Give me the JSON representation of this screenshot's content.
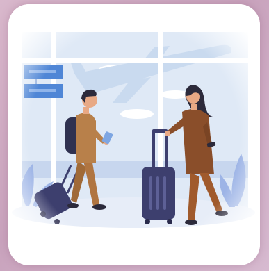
{
  "illustration": {
    "subject": "airport-travelers",
    "colors": {
      "sky": "#d8e6f6",
      "window_frame": "#ffffff",
      "board": "#4f86d6",
      "plane": "#c9daef",
      "floor": "#6b7fb1",
      "suitcase": "#3d3f6e",
      "man_shirt": "#b8804a",
      "man_hair": "#2c2a3b",
      "woman_coat": "#8a4e2a",
      "woman_pants": "#a05a2c",
      "plants": "#9db4e6"
    }
  }
}
